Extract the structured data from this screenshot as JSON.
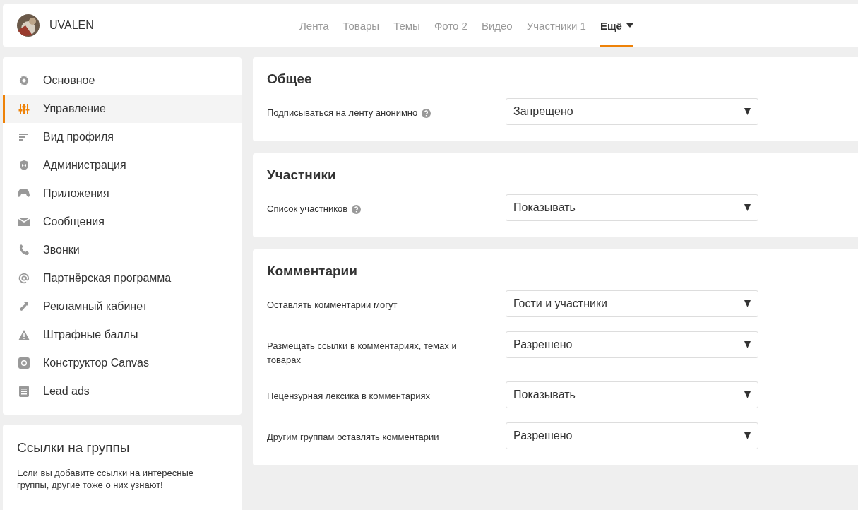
{
  "header": {
    "group_name": "UVALEN",
    "nav": [
      {
        "label": "Лента",
        "selected": false
      },
      {
        "label": "Товары",
        "selected": false
      },
      {
        "label": "Темы",
        "selected": false
      },
      {
        "label": "Фото 2",
        "selected": false
      },
      {
        "label": "Видео",
        "selected": false
      },
      {
        "label": "Участники 1",
        "selected": false
      },
      {
        "label": "Ещё",
        "selected": true,
        "dropdown": true
      }
    ]
  },
  "sidebar": {
    "items": [
      {
        "label": "Основное",
        "selected": false
      },
      {
        "label": "Управление",
        "selected": true
      },
      {
        "label": "Вид профиля",
        "selected": false
      },
      {
        "label": "Администрация",
        "selected": false
      },
      {
        "label": "Приложения",
        "selected": false
      },
      {
        "label": "Сообщения",
        "selected": false
      },
      {
        "label": "Звонки",
        "selected": false
      },
      {
        "label": "Партнёрская программа",
        "selected": false
      },
      {
        "label": "Рекламный кабинет",
        "selected": false
      },
      {
        "label": "Штрафные баллы",
        "selected": false
      },
      {
        "label": "Конструктор Canvas",
        "selected": false
      },
      {
        "label": "Lead ads",
        "selected": false
      }
    ],
    "links_card": {
      "title": "Ссылки на группы",
      "text": "Если вы добавите ссылки на интересные группы, другие тоже о них узнают!"
    }
  },
  "sections": [
    {
      "title": "Общее",
      "settings": [
        {
          "label": "Подписываться на ленту анонимно",
          "help": true,
          "value": "Запрещено"
        }
      ]
    },
    {
      "title": "Участники",
      "settings": [
        {
          "label": "Список участников",
          "help": true,
          "value": "Показывать"
        }
      ]
    },
    {
      "title": "Комментарии",
      "settings": [
        {
          "label": "Оставлять комментарии могут",
          "help": false,
          "value": "Гости и участники"
        },
        {
          "label": "Размещать ссылки в комментариях, темах и товарах",
          "help": false,
          "value": "Разрешено"
        },
        {
          "label": "Нецензурная лексика в комментариях",
          "help": false,
          "value": "Показывать"
        },
        {
          "label": "Другим группам оставлять комментарии",
          "help": false,
          "value": "Разрешено"
        }
      ]
    }
  ]
}
